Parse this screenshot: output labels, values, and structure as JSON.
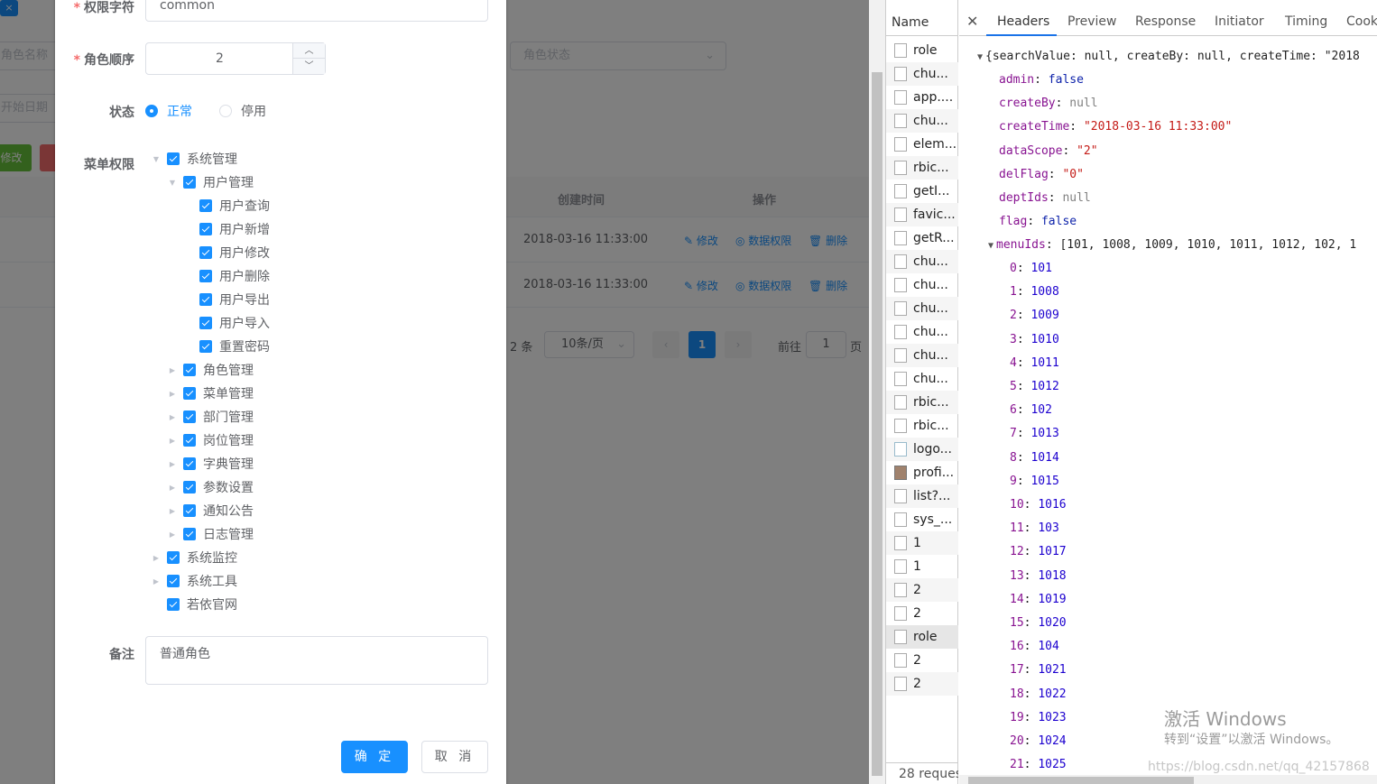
{
  "background": {
    "search": {
      "role_name_placeholder": "角色名称",
      "start_date_placeholder": "开始日期",
      "status_placeholder": "角色状态"
    },
    "buttons": {
      "edit_label": "修改"
    },
    "table": {
      "headers": [
        "创建时间",
        "操作"
      ],
      "rows": [
        {
          "created": "2018-03-16 11:33:00"
        },
        {
          "created": "2018-03-16 11:33:00"
        }
      ],
      "actions": {
        "edit": "修改",
        "data_scope": "数据权限",
        "delete": "删除"
      }
    },
    "pagination": {
      "total": "2 条",
      "page_size": "10条/页",
      "current": "1",
      "goto_label": "前往",
      "goto_value": "1",
      "page_suffix": "页"
    }
  },
  "dialog": {
    "fields": {
      "role_key": {
        "label": "权限字符",
        "value": "common"
      },
      "role_sort": {
        "label": "角色顺序",
        "value": "2"
      },
      "status": {
        "label": "状态",
        "options": [
          "正常",
          "停用"
        ],
        "selected": "正常"
      },
      "menu": {
        "label": "菜单权限"
      },
      "remark": {
        "label": "备注",
        "value": "普通角色"
      }
    },
    "tree": {
      "root1": "系统管理",
      "user_mgmt": "用户管理",
      "user_children": [
        "用户查询",
        "用户新增",
        "用户修改",
        "用户删除",
        "用户导出",
        "用户导入",
        "重置密码"
      ],
      "siblings": [
        "角色管理",
        "菜单管理",
        "部门管理",
        "岗位管理",
        "字典管理",
        "参数设置",
        "通知公告",
        "日志管理"
      ],
      "root2": "系统监控",
      "root3": "系统工具",
      "root4": "若依官网"
    },
    "buttons": {
      "confirm": "确 定",
      "cancel": "取 消"
    }
  },
  "devtools": {
    "name_header": "Name",
    "requests": [
      "role",
      "chu...",
      "app....",
      "chu...",
      "elem...",
      "rbic...",
      "getI...",
      "favic...",
      "getR...",
      "chu...",
      "chu...",
      "chu...",
      "chu...",
      "chu...",
      "chu...",
      "rbic...",
      "rbic...",
      "logo...",
      "profi...",
      "list?...",
      "sys_...",
      "1",
      "1",
      "2",
      "2",
      "role",
      "2",
      "2"
    ],
    "footer": "28 reques",
    "tabs": [
      "Headers",
      "Preview",
      "Response",
      "Initiator",
      "Timing",
      "Cook"
    ],
    "active_tab": "Headers",
    "preview": {
      "summary": "{searchValue: null, createBy: null, createTime: \"2018",
      "fields": [
        {
          "key": "admin",
          "value": "false",
          "type": "b"
        },
        {
          "key": "createBy",
          "value": "null",
          "type": "nul"
        },
        {
          "key": "createTime",
          "value": "\"2018-03-16 11:33:00\"",
          "type": "s"
        },
        {
          "key": "dataScope",
          "value": "\"2\"",
          "type": "s"
        },
        {
          "key": "delFlag",
          "value": "\"0\"",
          "type": "s"
        },
        {
          "key": "deptIds",
          "value": "null",
          "type": "nul"
        },
        {
          "key": "flag",
          "value": "false",
          "type": "b"
        }
      ],
      "menu_ids_key": "menuIds",
      "menu_ids_summary": "[101, 1008, 1009, 1010, 1011, 1012, 102, 1",
      "menu_ids": [
        {
          "i": "0",
          "v": "101"
        },
        {
          "i": "1",
          "v": "1008"
        },
        {
          "i": "2",
          "v": "1009"
        },
        {
          "i": "3",
          "v": "1010"
        },
        {
          "i": "4",
          "v": "1011"
        },
        {
          "i": "5",
          "v": "1012"
        },
        {
          "i": "6",
          "v": "102"
        },
        {
          "i": "7",
          "v": "1013"
        },
        {
          "i": "8",
          "v": "1014"
        },
        {
          "i": "9",
          "v": "1015"
        },
        {
          "i": "10",
          "v": "1016"
        },
        {
          "i": "11",
          "v": "103"
        },
        {
          "i": "12",
          "v": "1017"
        },
        {
          "i": "13",
          "v": "1018"
        },
        {
          "i": "14",
          "v": "1019"
        },
        {
          "i": "15",
          "v": "1020"
        },
        {
          "i": "16",
          "v": "104"
        },
        {
          "i": "17",
          "v": "1021"
        },
        {
          "i": "18",
          "v": "1022"
        },
        {
          "i": "19",
          "v": "1023"
        },
        {
          "i": "20",
          "v": "1024"
        },
        {
          "i": "21",
          "v": "1025"
        }
      ]
    }
  },
  "watermarks": {
    "activate_title": "激活 Windows",
    "activate_sub": "转到“设置”以激活 Windows。",
    "url": "https://blog.csdn.net/qq_42157868"
  },
  "colors": {
    "primary": "#1890ff",
    "success": "#67c23a",
    "danger": "#f56c6c"
  }
}
